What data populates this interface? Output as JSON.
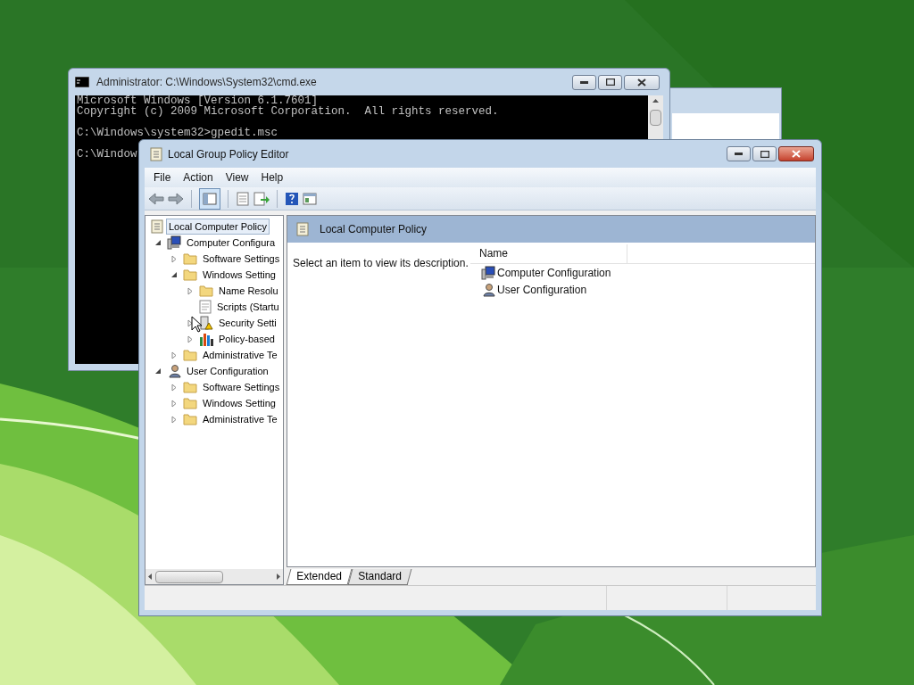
{
  "console_window": {
    "title": "Administrator: C:\\Windows\\System32\\cmd.exe",
    "blocks": [
      [
        "Microsoft Windows [Version 6.1.7601]",
        "Copyright (c) 2009 Microsoft Corporation.  All rights reserved."
      ],
      [
        "C:\\Windows\\system32>gpedit.msc"
      ],
      [
        "C:\\Window"
      ]
    ]
  },
  "editor_window": {
    "title": "Local Group Policy Editor",
    "menu": [
      "File",
      "Action",
      "View",
      "Help"
    ],
    "toolbar": [
      {
        "kind": "back"
      },
      {
        "kind": "forward"
      },
      {
        "kind": "separator"
      },
      {
        "kind": "pane",
        "selected": true
      },
      {
        "kind": "separator"
      },
      {
        "kind": "properties"
      },
      {
        "kind": "export"
      },
      {
        "kind": "separator"
      },
      {
        "kind": "help"
      },
      {
        "kind": "view"
      }
    ],
    "tree": [
      {
        "label": "Local Computer Policy",
        "kind": "policy",
        "selected": true,
        "children": [
          {
            "label": "Computer Configura",
            "kind": "computer",
            "selected": false,
            "expanded": true,
            "children": [
              {
                "label": "Software Settings",
                "kind": "folder",
                "selected": false,
                "expanded": false
              },
              {
                "label": "Windows Setting",
                "kind": "folder",
                "selected": false,
                "expanded": true,
                "children": [
                  {
                    "label": "Name Resolu",
                    "kind": "folder",
                    "selected": false,
                    "expanded": false
                  },
                  {
                    "label": "Scripts (Startu",
                    "kind": "script",
                    "selected": false
                  },
                  {
                    "label": "Security Setti",
                    "kind": "security",
                    "selected": false,
                    "expanded": false
                  },
                  {
                    "label": "Policy-based",
                    "kind": "chart",
                    "selected": false,
                    "expanded": false
                  }
                ]
              },
              {
                "label": "Administrative Te",
                "kind": "folder",
                "selected": false,
                "expanded": false
              }
            ]
          },
          {
            "label": "User Configuration",
            "kind": "user",
            "selected": false,
            "expanded": true,
            "children": [
              {
                "label": "Software Settings",
                "kind": "folder",
                "selected": false,
                "expanded": false
              },
              {
                "label": "Windows Setting",
                "kind": "folder",
                "selected": false,
                "expanded": false
              },
              {
                "label": "Administrative Te",
                "kind": "folder",
                "selected": false,
                "expanded": false
              }
            ]
          }
        ]
      }
    ],
    "header": "Local Computer Policy",
    "description": "Select an item to view its description.",
    "list": {
      "columns": [
        "Name"
      ],
      "rows": [
        {
          "name": "Computer Configuration",
          "kind": "computer"
        },
        {
          "name": "User Configuration",
          "kind": "user"
        }
      ]
    },
    "tabs": [
      {
        "label": "Extended",
        "selected": true
      },
      {
        "label": "Standard",
        "selected": false
      }
    ]
  }
}
